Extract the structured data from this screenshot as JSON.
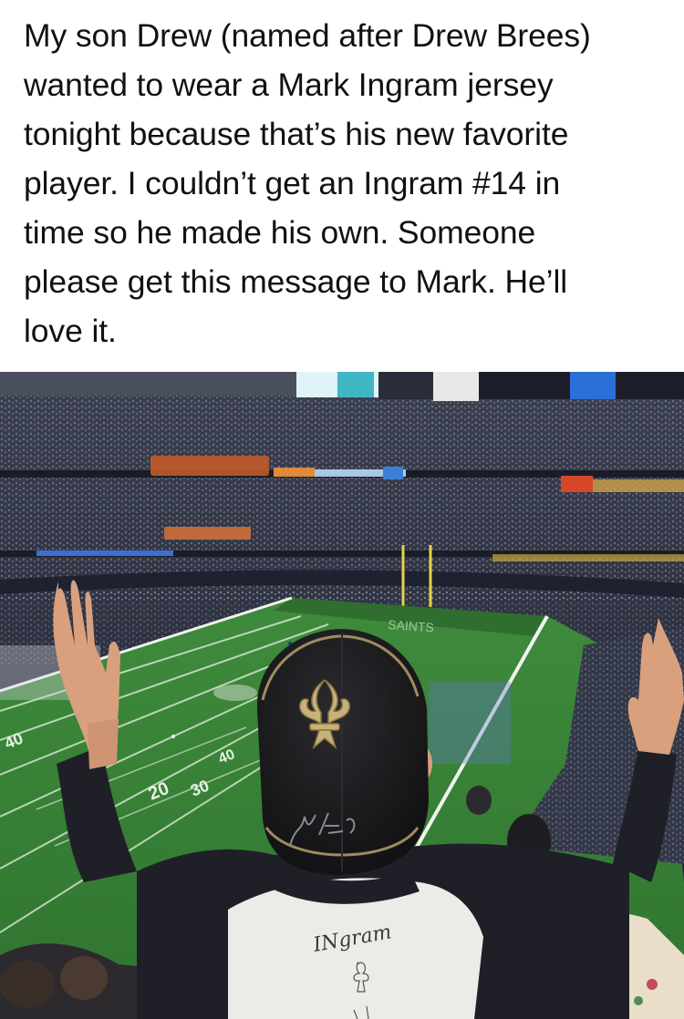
{
  "post": {
    "text_lines": [
      "My son Drew (named after Drew Brees)",
      "wanted to wear a Mark Ingram jersey",
      "tonight because that’s his new favorite",
      "player. I couldn’t get an Ingram #14 in",
      "time so he made his own. Someone",
      "please get this message to Mark. He’ll",
      "love it."
    ]
  },
  "photo": {
    "shirt_text": "INgram",
    "yard_numbers": [
      "40",
      "30",
      "20"
    ],
    "colors": {
      "turf": "#3f8a3a",
      "turf_dark": "#2f6f2d",
      "crowd": "#2a2d3c",
      "cap": "#1a1a1c",
      "cap_logo": "#c9b27a",
      "sleeve": "#22232a",
      "shirt": "#ecebe8",
      "skin": "#d9a07e"
    }
  }
}
